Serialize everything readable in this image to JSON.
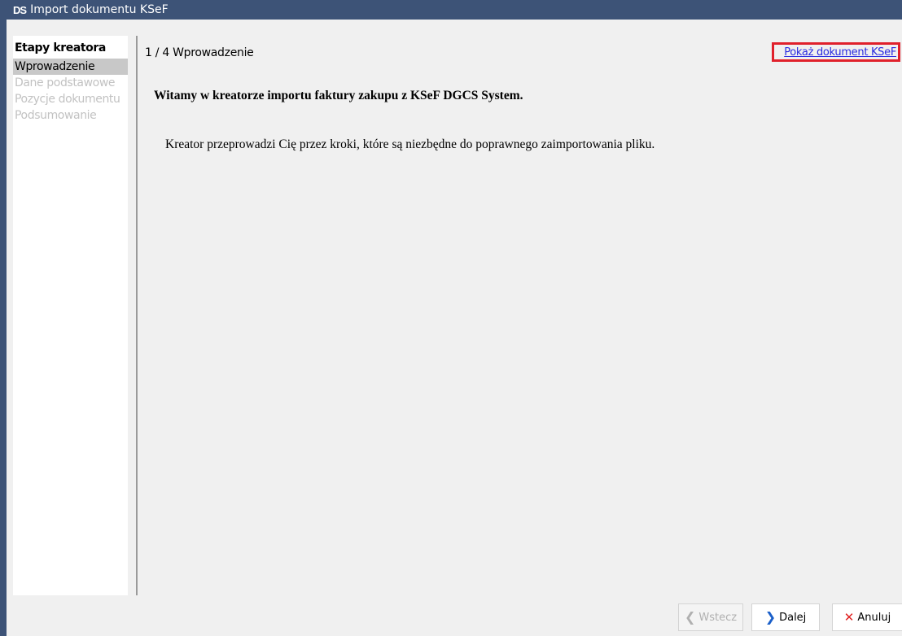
{
  "window": {
    "logo": "DS",
    "title": "Import dokumentu KSeF"
  },
  "sidebar": {
    "title": "Etapy kreatora",
    "steps": [
      {
        "label": "Wprowadzenie",
        "active": true
      },
      {
        "label": "Dane podstawowe",
        "active": false
      },
      {
        "label": "Pozycje dokumentu",
        "active": false
      },
      {
        "label": "Podsumowanie",
        "active": false
      }
    ]
  },
  "main": {
    "step_header": "1 / 4 Wprowadzenie",
    "show_document_link": "Pokaż dokument KSeF",
    "welcome_text": "Witamy w kreatorze importu faktury zakupu z KSeF DGCS System.",
    "intro_text": "Kreator przeprowadzi Cię przez kroki, które są niezbędne do poprawnego zaimportowania pliku."
  },
  "buttons": {
    "back": "Wstecz",
    "next": "Dalej",
    "cancel": "Anuluj"
  },
  "colors": {
    "titlebar": "#3d5377",
    "highlight_border": "#e0202b",
    "link": "#2a2ae0",
    "next_icon": "#1a5fc9",
    "cancel_icon": "#e02222"
  }
}
